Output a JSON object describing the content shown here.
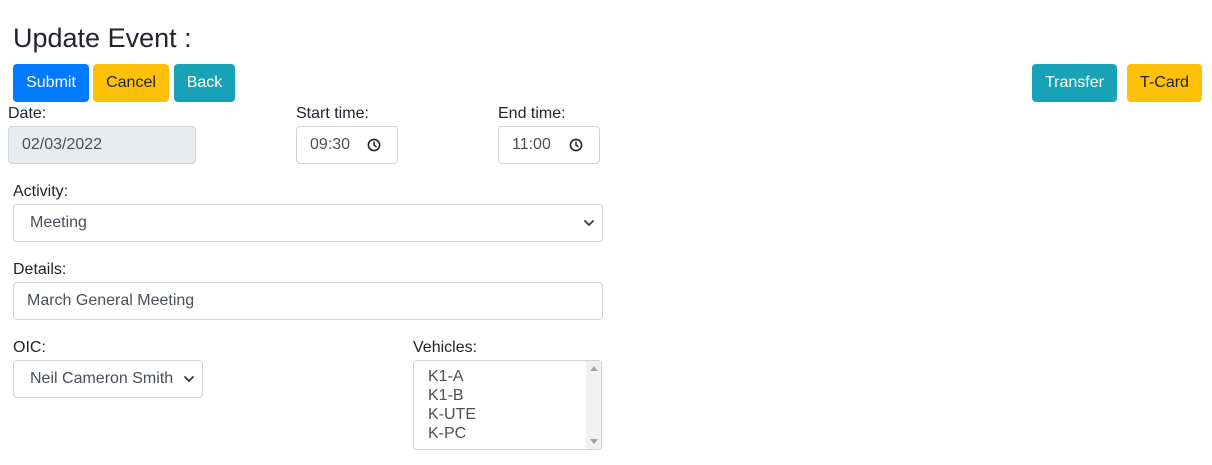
{
  "header": {
    "title": "Update Event :"
  },
  "toolbar": {
    "submit_label": "Submit",
    "cancel_label": "Cancel",
    "back_label": "Back",
    "transfer_label": "Transfer",
    "tcard_label": "T-Card"
  },
  "form": {
    "date": {
      "label": "Date:",
      "value": "02/03/2022"
    },
    "start_time": {
      "label": "Start time:",
      "value": "09:30"
    },
    "end_time": {
      "label": "End time:",
      "value": "11:00"
    },
    "activity": {
      "label": "Activity:",
      "selected": "Meeting"
    },
    "details": {
      "label": "Details:",
      "value": "March General Meeting"
    },
    "oic": {
      "label": "OIC:",
      "selected": "Neil Cameron Smith"
    },
    "vehicles": {
      "label": "Vehicles:",
      "options": [
        "K1-A",
        "K1-B",
        "K-UTE",
        "K-PC"
      ]
    }
  },
  "colors": {
    "primary": "#007bff",
    "warning": "#ffc107",
    "info": "#17a2b8"
  },
  "icons": {
    "time": "clock-icon",
    "dropdown": "chevron-down-icon"
  }
}
